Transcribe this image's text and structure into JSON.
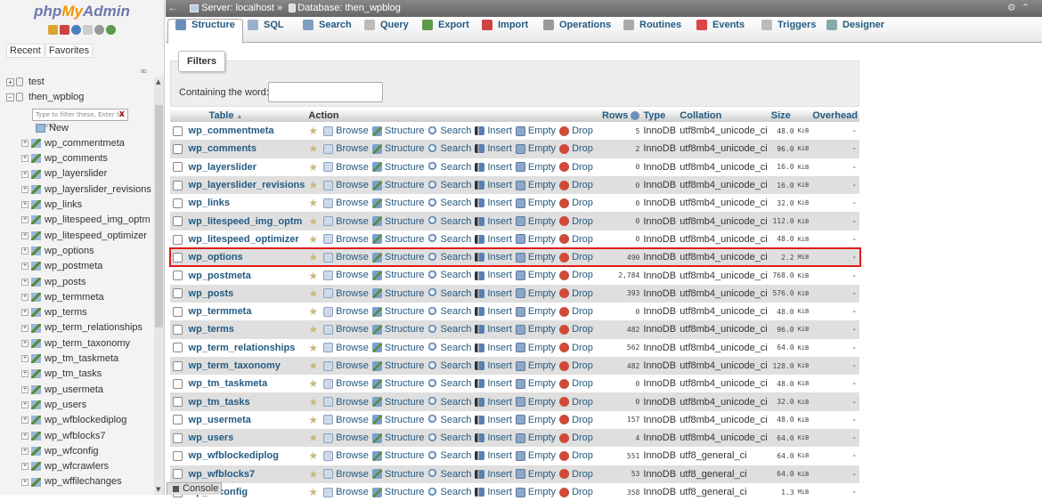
{
  "nav": {
    "logo": {
      "php": "php",
      "my": "My",
      "admin": "Admin"
    },
    "recent_label": "Recent",
    "favorites_label": "Favorites",
    "databases": [
      {
        "name": "test",
        "expanded": false
      },
      {
        "name": "then_wpblog",
        "expanded": true
      }
    ],
    "filter_placeholder": "Type to filter these, Enter to search",
    "filter_clear": "X",
    "new_label": "New",
    "tables": [
      "wp_commentmeta",
      "wp_comments",
      "wp_layerslider",
      "wp_layerslider_revisions",
      "wp_links",
      "wp_litespeed_img_optm",
      "wp_litespeed_optimizer",
      "wp_options",
      "wp_postmeta",
      "wp_posts",
      "wp_termmeta",
      "wp_terms",
      "wp_term_relationships",
      "wp_term_taxonomy",
      "wp_tm_taskmeta",
      "wp_tm_tasks",
      "wp_usermeta",
      "wp_users",
      "wp_wfblockediplog",
      "wp_wfblocks7",
      "wp_wfconfig",
      "wp_wfcrawlers",
      "wp_wffilechanges"
    ]
  },
  "topbar": {
    "server": "Server: localhost",
    "separator": "»",
    "database": "Database: then_wpblog"
  },
  "tabs": [
    {
      "label": "Structure",
      "icon": "structure-icon",
      "color": "#6a8fb8"
    },
    {
      "label": "SQL",
      "icon": "sql-icon",
      "color": "#9ab0cc"
    },
    {
      "label": "Search",
      "icon": "search-icon",
      "color": "#7f9fc0"
    },
    {
      "label": "Query",
      "icon": "query-icon",
      "color": "#bbb"
    },
    {
      "label": "Export",
      "icon": "export-icon",
      "color": "#5a9a4a"
    },
    {
      "label": "Import",
      "icon": "import-icon",
      "color": "#c44"
    },
    {
      "label": "Operations",
      "icon": "wrench-icon",
      "color": "#999"
    },
    {
      "label": "Routines",
      "icon": "routines-icon",
      "color": "#aaa"
    },
    {
      "label": "Events",
      "icon": "clock-icon",
      "color": "#d44"
    },
    {
      "label": "Triggers",
      "icon": "triggers-icon",
      "color": "#bbb"
    },
    {
      "label": "Designer",
      "icon": "designer-icon",
      "color": "#8aa"
    }
  ],
  "filters": {
    "legend": "Filters",
    "label": "Containing the word:",
    "value": ""
  },
  "table_headers": {
    "table": "Table",
    "sort_indicator": "▲",
    "action": "Action",
    "rows": "Rows",
    "type": "Type",
    "collation": "Collation",
    "size": "Size",
    "overhead": "Overhead"
  },
  "action_labels": {
    "browse": "Browse",
    "structure": "Structure",
    "search": "Search",
    "insert": "Insert",
    "empty": "Empty",
    "drop": "Drop"
  },
  "highlight_color": "#e01a1a",
  "rows": [
    {
      "name": "wp_commentmeta",
      "rows": "5",
      "type": "InnoDB",
      "collation": "utf8mb4_unicode_ci",
      "size": "48.0",
      "unit": "KiB",
      "overhead": "-"
    },
    {
      "name": "wp_comments",
      "rows": "2",
      "type": "InnoDB",
      "collation": "utf8mb4_unicode_ci",
      "size": "96.0",
      "unit": "KiB",
      "overhead": "-"
    },
    {
      "name": "wp_layerslider",
      "rows": "0",
      "type": "InnoDB",
      "collation": "utf8mb4_unicode_ci",
      "size": "16.0",
      "unit": "KiB",
      "overhead": "-"
    },
    {
      "name": "wp_layerslider_revisions",
      "rows": "0",
      "type": "InnoDB",
      "collation": "utf8mb4_unicode_ci",
      "size": "16.0",
      "unit": "KiB",
      "overhead": "-"
    },
    {
      "name": "wp_links",
      "rows": "0",
      "type": "InnoDB",
      "collation": "utf8mb4_unicode_ci",
      "size": "32.0",
      "unit": "KiB",
      "overhead": "-"
    },
    {
      "name": "wp_litespeed_img_optm",
      "rows": "0",
      "type": "InnoDB",
      "collation": "utf8mb4_unicode_ci",
      "size": "112.0",
      "unit": "KiB",
      "overhead": "-"
    },
    {
      "name": "wp_litespeed_optimizer",
      "rows": "0",
      "type": "InnoDB",
      "collation": "utf8mb4_unicode_ci",
      "size": "48.0",
      "unit": "KiB",
      "overhead": "-"
    },
    {
      "name": "wp_options",
      "rows": "490",
      "type": "InnoDB",
      "collation": "utf8mb4_unicode_ci",
      "size": "2.2",
      "unit": "MiB",
      "overhead": "-",
      "highlighted": true
    },
    {
      "name": "wp_postmeta",
      "rows": "2,784",
      "type": "InnoDB",
      "collation": "utf8mb4_unicode_ci",
      "size": "768.0",
      "unit": "KiB",
      "overhead": "-"
    },
    {
      "name": "wp_posts",
      "rows": "393",
      "type": "InnoDB",
      "collation": "utf8mb4_unicode_ci",
      "size": "576.0",
      "unit": "KiB",
      "overhead": "-"
    },
    {
      "name": "wp_termmeta",
      "rows": "0",
      "type": "InnoDB",
      "collation": "utf8mb4_unicode_ci",
      "size": "48.0",
      "unit": "KiB",
      "overhead": "-"
    },
    {
      "name": "wp_terms",
      "rows": "482",
      "type": "InnoDB",
      "collation": "utf8mb4_unicode_ci",
      "size": "96.0",
      "unit": "KiB",
      "overhead": "-"
    },
    {
      "name": "wp_term_relationships",
      "rows": "562",
      "type": "InnoDB",
      "collation": "utf8mb4_unicode_ci",
      "size": "64.0",
      "unit": "KiB",
      "overhead": "-"
    },
    {
      "name": "wp_term_taxonomy",
      "rows": "482",
      "type": "InnoDB",
      "collation": "utf8mb4_unicode_ci",
      "size": "128.0",
      "unit": "KiB",
      "overhead": "-"
    },
    {
      "name": "wp_tm_taskmeta",
      "rows": "0",
      "type": "InnoDB",
      "collation": "utf8mb4_unicode_ci",
      "size": "48.0",
      "unit": "KiB",
      "overhead": "-"
    },
    {
      "name": "wp_tm_tasks",
      "rows": "0",
      "type": "InnoDB",
      "collation": "utf8mb4_unicode_ci",
      "size": "32.0",
      "unit": "KiB",
      "overhead": "-"
    },
    {
      "name": "wp_usermeta",
      "rows": "157",
      "type": "InnoDB",
      "collation": "utf8mb4_unicode_ci",
      "size": "48.0",
      "unit": "KiB",
      "overhead": "-"
    },
    {
      "name": "wp_users",
      "rows": "4",
      "type": "InnoDB",
      "collation": "utf8mb4_unicode_ci",
      "size": "64.0",
      "unit": "KiB",
      "overhead": "-"
    },
    {
      "name": "wp_wfblockediplog",
      "rows": "551",
      "type": "InnoDB",
      "collation": "utf8_general_ci",
      "size": "64.0",
      "unit": "KiB",
      "overhead": "-"
    },
    {
      "name": "wp_wfblocks7",
      "rows": "53",
      "type": "InnoDB",
      "collation": "utf8_general_ci",
      "size": "64.0",
      "unit": "KiB",
      "overhead": "-"
    },
    {
      "name": "wp_wfconfig",
      "rows": "358",
      "type": "InnoDB",
      "collation": "utf8_general_ci",
      "size": "1.3",
      "unit": "MiB",
      "overhead": "-"
    }
  ],
  "console_label": "Console"
}
